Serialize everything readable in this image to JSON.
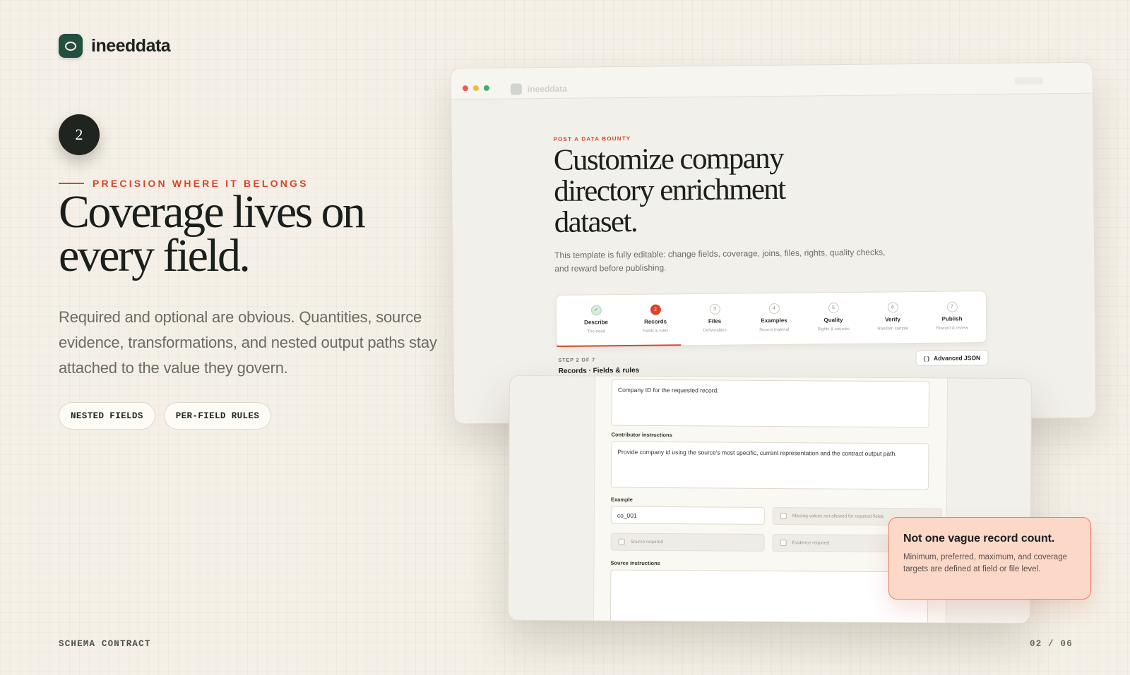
{
  "brand": {
    "name": "ineeddata"
  },
  "slide": {
    "step_number": "2",
    "eyebrow": "PRECISION WHERE IT BELONGS",
    "headline_line1": "Coverage lives on",
    "headline_line2": "every field.",
    "lead": "Required and optional are obvious. Quantities, source evidence, transformations, and nested output paths stay attached to the value they govern.",
    "chips": [
      "NESTED FIELDS",
      "PER-FIELD RULES"
    ],
    "footer_label": "SCHEMA CONTRACT",
    "pagination": "02 / 06"
  },
  "window": {
    "traffic_colors": [
      "#ec5a4d",
      "#f0b93a",
      "#3fae6a"
    ],
    "ghost_brand": "ineeddata",
    "eyebrow": "POST A DATA BOUNTY",
    "title": "Customize company directory enrichment dataset.",
    "description": "This template is fully editable: change fields, coverage, joins, files, rights, quality checks, and reward before publishing.",
    "steps": [
      {
        "num": "✓",
        "name": "Describe",
        "sub": "The need",
        "state": "done"
      },
      {
        "num": "2",
        "name": "Records",
        "sub": "Fields & rules",
        "state": "active"
      },
      {
        "num": "3",
        "name": "Files",
        "sub": "Deliverables",
        "state": "todo"
      },
      {
        "num": "4",
        "name": "Examples",
        "sub": "Source material",
        "state": "todo"
      },
      {
        "num": "5",
        "name": "Quality",
        "sub": "Rights & sources",
        "state": "todo"
      },
      {
        "num": "6",
        "name": "Verify",
        "sub": "Random sample",
        "state": "todo"
      },
      {
        "num": "7",
        "name": "Publish",
        "sub": "Reward & review",
        "state": "todo"
      }
    ],
    "step_meta": "STEP 2 OF 7",
    "step_title": "Records · Fields & rules",
    "advanced_json": "Advanced JSON"
  },
  "form": {
    "description_value": "Company ID for the requested record.",
    "contributor_label": "Contributor instructions",
    "contributor_value": "Provide company id using the source's most specific, current representation and the contract output path.",
    "example_label": "Example",
    "example_value": "co_001",
    "missing_values": "Missing values not allowed for required fields",
    "source_required": "Source required",
    "evidence_required": "Evidence required",
    "source_instructions_label": "Source instructions"
  },
  "callout": {
    "title": "Not one vague record count.",
    "body": "Minimum, preferred, maximum, and coverage targets are defined at field or file level."
  }
}
